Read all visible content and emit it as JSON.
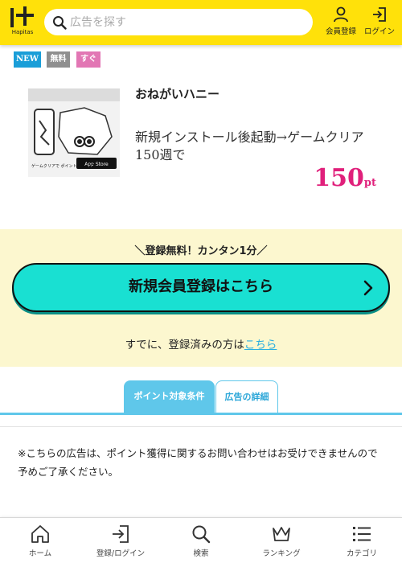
{
  "header": {
    "logo_text": "Hapitas",
    "search_placeholder": "広告を探す",
    "register_label": "会員登録",
    "login_label": "ログイン"
  },
  "badges": {
    "new": "NEW",
    "free": "無料",
    "soon": "すぐ"
  },
  "ad": {
    "title": "おねがいハニー",
    "condition_line1": "新規インストール後起動→ゲームクリア",
    "condition_line2": "150週で",
    "points_value": "150",
    "points_unit": "pt",
    "thumbnail_caption": "ゲームクリアで ポイントもらえる!",
    "thumbnail_store": "App Store"
  },
  "register": {
    "catch": "＼登録無料！カンタン1分／",
    "button_label": "新規会員登録はこちら",
    "login_prefix": "すでに、登録済みの方は",
    "login_link": "こちら"
  },
  "tabs": [
    {
      "label": "ポイント対象条件",
      "active": true
    },
    {
      "label": "広告の詳細",
      "active": false
    }
  ],
  "notice": "※こちらの広告は、ポイント獲得に関するお問い合わせはお受けできませんので予めご了承ください。",
  "bottom_nav": [
    {
      "label": "ホーム",
      "icon": "home-icon"
    },
    {
      "label": "登録/ログイン",
      "icon": "login-icon"
    },
    {
      "label": "検索",
      "icon": "search-icon"
    },
    {
      "label": "ランキング",
      "icon": "crown-icon"
    },
    {
      "label": "カテゴリ",
      "icon": "list-icon"
    }
  ],
  "colors": {
    "header": "#ffe10a",
    "register_bg": "#fcf7cf",
    "register_button": "#19e0d2",
    "points": "#e0207b",
    "tab_active": "#5fc7ea"
  }
}
